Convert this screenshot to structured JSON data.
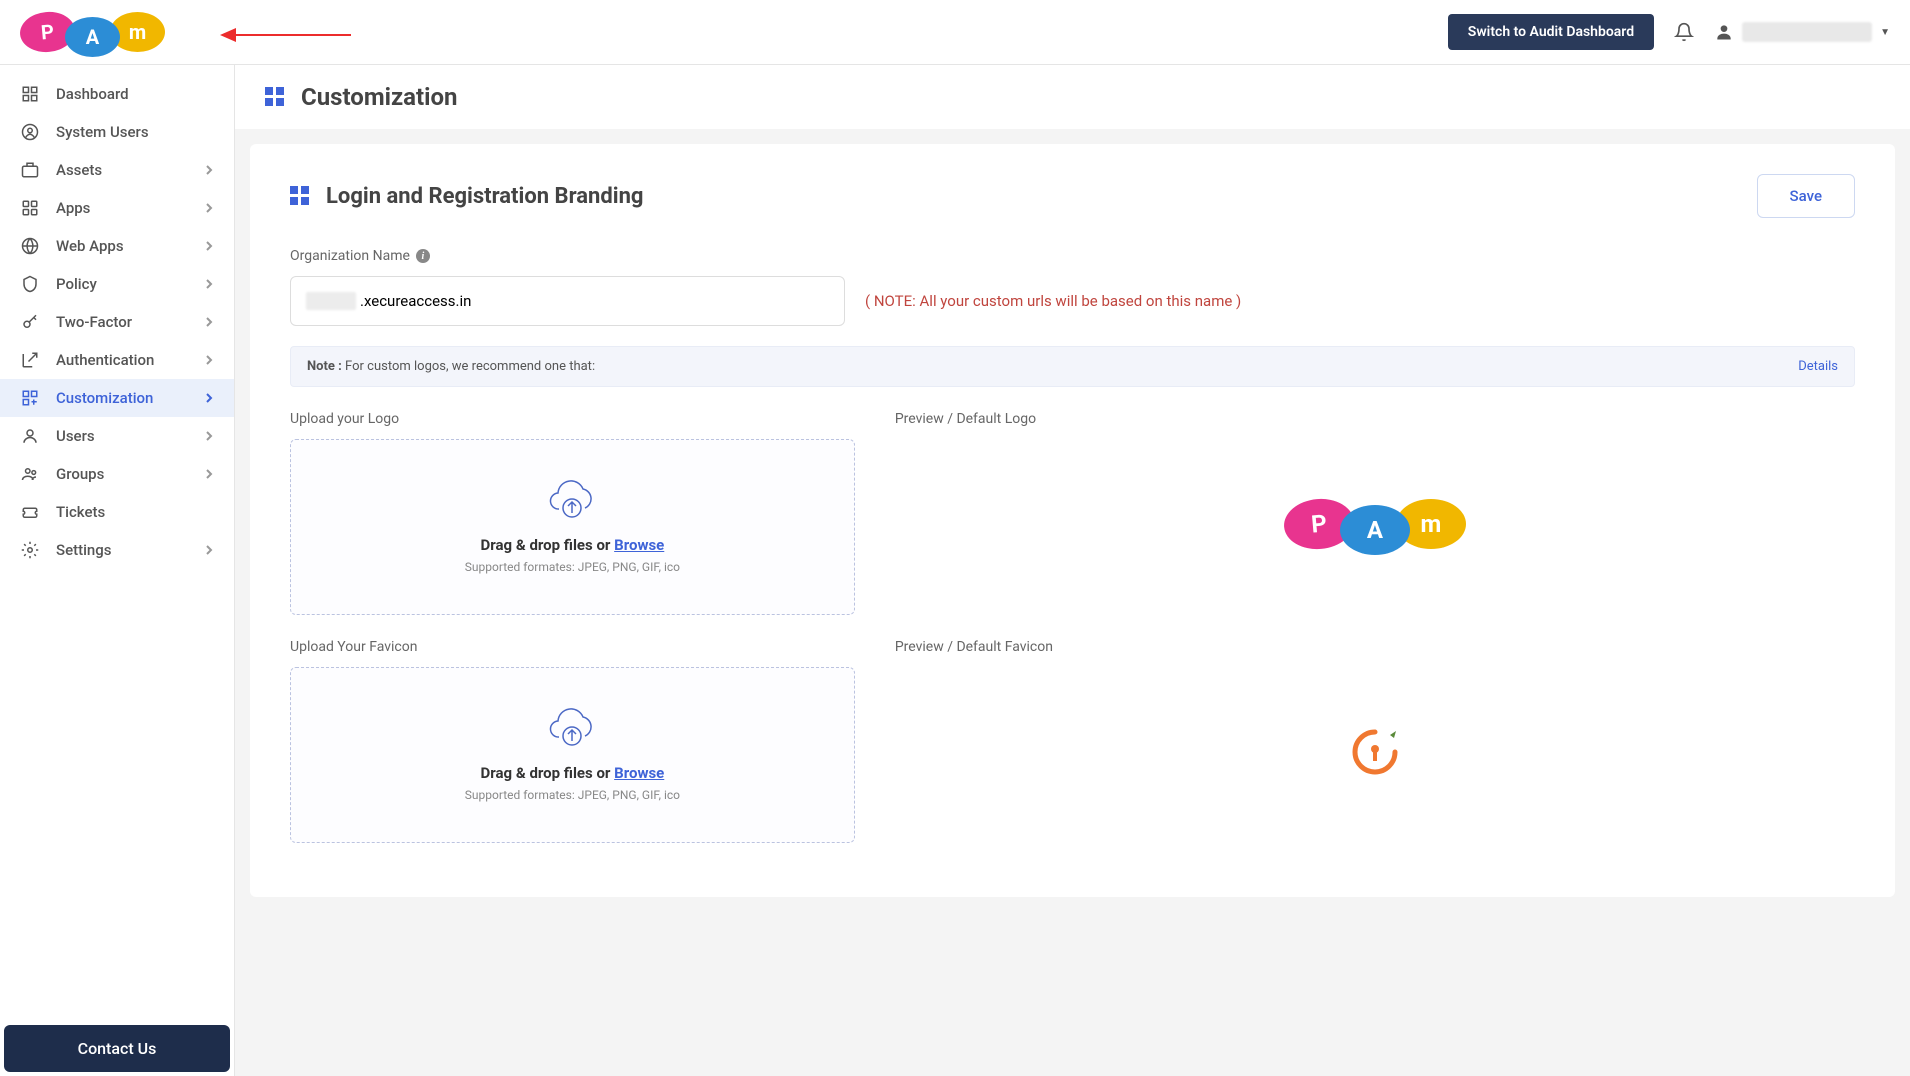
{
  "header": {
    "audit_button": "Switch to Audit Dashboard"
  },
  "sidebar": {
    "items": [
      {
        "label": "Dashboard",
        "expandable": false
      },
      {
        "label": "System Users",
        "expandable": false
      },
      {
        "label": "Assets",
        "expandable": true
      },
      {
        "label": "Apps",
        "expandable": true
      },
      {
        "label": "Web Apps",
        "expandable": true
      },
      {
        "label": "Policy",
        "expandable": true
      },
      {
        "label": "Two-Factor",
        "expandable": true
      },
      {
        "label": "Authentication",
        "expandable": true
      },
      {
        "label": "Customization",
        "expandable": true,
        "active": true
      },
      {
        "label": "Users",
        "expandable": true
      },
      {
        "label": "Groups",
        "expandable": true
      },
      {
        "label": "Tickets",
        "expandable": false
      },
      {
        "label": "Settings",
        "expandable": true
      }
    ],
    "contact": "Contact Us"
  },
  "page": {
    "title": "Customization",
    "card_title": "Login and Registration Branding",
    "save_button": "Save",
    "org_label": "Organization Name",
    "org_value_suffix": ".xecureaccess.in",
    "org_note": "( NOTE: All your custom urls will be based on this name )",
    "note_bar_prefix": "Note :",
    "note_bar_text": " For custom logos, we recommend one that:",
    "details_link": "Details",
    "upload_logo_label": "Upload your Logo",
    "preview_logo_label": "Preview / Default Logo",
    "upload_favicon_label": "Upload Your Favicon",
    "preview_favicon_label": "Preview / Default Favicon",
    "dropzone_text": "Drag & drop files or ",
    "browse": "Browse",
    "dropzone_subtext": "Supported formates: JPEG, PNG, GIF, ico"
  }
}
